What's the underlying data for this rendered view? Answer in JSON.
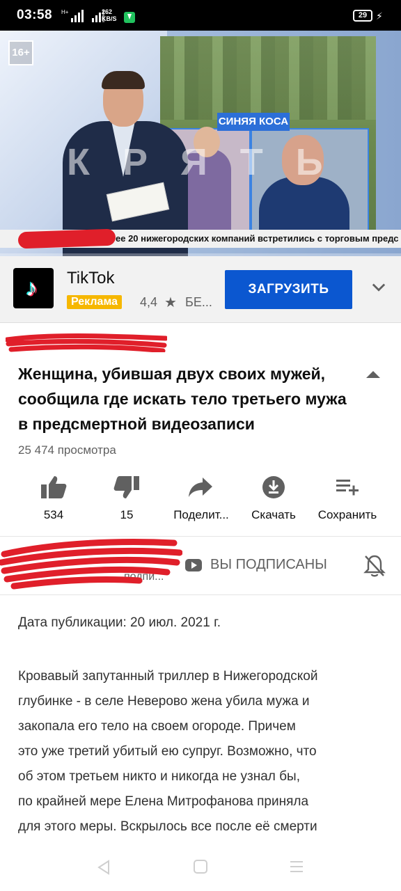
{
  "status_bar": {
    "time": "03:58",
    "network_tag": "H+",
    "speed_value": "262",
    "speed_unit": "KB/S",
    "battery": "29"
  },
  "video": {
    "age_rating": "16+",
    "location_tag": "СИНЯЯ КОСА",
    "watermark": "К Р Я Т Ь",
    "ticker": "ее 20 нижегородских компаний встретились с торговым предс",
    "progress": 0.0
  },
  "ad": {
    "title": "TikTok",
    "badge": "Реклама",
    "rating": "4,4",
    "meta": "БЕ...",
    "button_label": "ЗАГРУЗИТЬ"
  },
  "video_info": {
    "hashtags": "#...",
    "title": "Женщина, убившая двух своих мужей, сообщила где искать тело третьего мужа в предсмертной видеозаписи",
    "views": "25 474 просмотра"
  },
  "actions": {
    "like_count": "534",
    "dislike_count": "15",
    "share_label": "Поделит...",
    "download_label": "Скачать",
    "save_label": "Сохранить"
  },
  "channel": {
    "subscribers_partial": "подпи...",
    "subscribed_label": "ВЫ ПОДПИСАНЫ"
  },
  "description": {
    "pubdate": "Дата публикации: 20 июл. 2021 г.",
    "lines": [
      "Кровавый запутанный триллер в Нижегородской",
      "глубинке - в селе Неверово жена убила мужа и",
      "закопала его тело на своем огороде. Причем",
      "это уже третий убитый ею супруг. Возможно, что",
      "об этом третьем никто и никогда не узнал бы,",
      "по крайней мере Елена Митрофанова приняла",
      "для этого меры. Вскрылось все после её смерти"
    ]
  },
  "colors": {
    "accent": "#0b57d0",
    "ad_badge": "#f6b700",
    "scribble": "#e01f2a",
    "progress": "#ff0000"
  }
}
